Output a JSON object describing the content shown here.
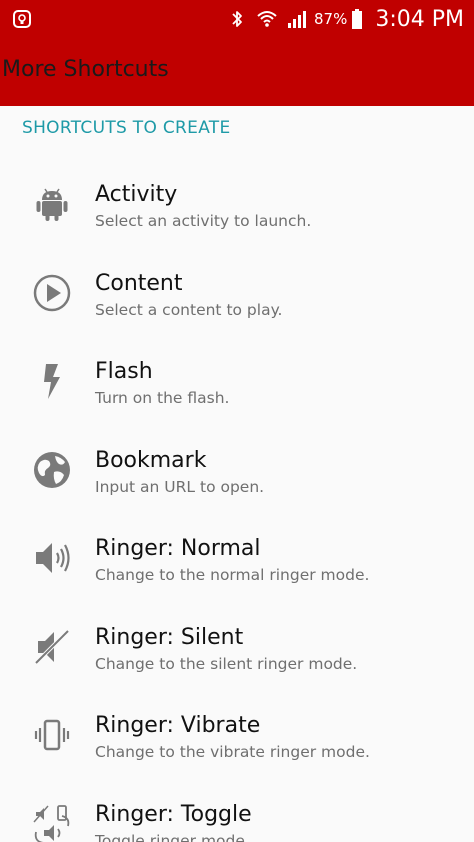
{
  "status_bar": {
    "battery": "87%",
    "time": "3:04 PM",
    "icons": [
      "notification-icon",
      "bluetooth-icon",
      "wifi-icon",
      "signal-icon",
      "battery-icon"
    ]
  },
  "app_bar": {
    "title": "More Shortcuts"
  },
  "section": {
    "header": "SHORTCUTS TO CREATE"
  },
  "items": [
    {
      "icon": "android-icon",
      "label": "Activity",
      "desc": "Select an activity to launch."
    },
    {
      "icon": "play-icon",
      "label": "Content",
      "desc": "Select a content to play."
    },
    {
      "icon": "flash-icon",
      "label": "Flash",
      "desc": "Turn on the flash."
    },
    {
      "icon": "globe-icon",
      "label": "Bookmark",
      "desc": "Input an URL to open."
    },
    {
      "icon": "speaker-icon",
      "label": "Ringer: Normal",
      "desc": "Change to the normal ringer mode."
    },
    {
      "icon": "speaker-muted-icon",
      "label": "Ringer: Silent",
      "desc": "Change to the silent ringer mode."
    },
    {
      "icon": "vibrate-icon",
      "label": "Ringer: Vibrate",
      "desc": "Change to the vibrate ringer mode."
    },
    {
      "icon": "ringer-toggle-icon",
      "label": "Ringer: Toggle",
      "desc": "Toggle ringer mode."
    }
  ],
  "colors": {
    "primary": "#c00000",
    "accent": "#1e9aa7",
    "background": "#fafafa"
  }
}
